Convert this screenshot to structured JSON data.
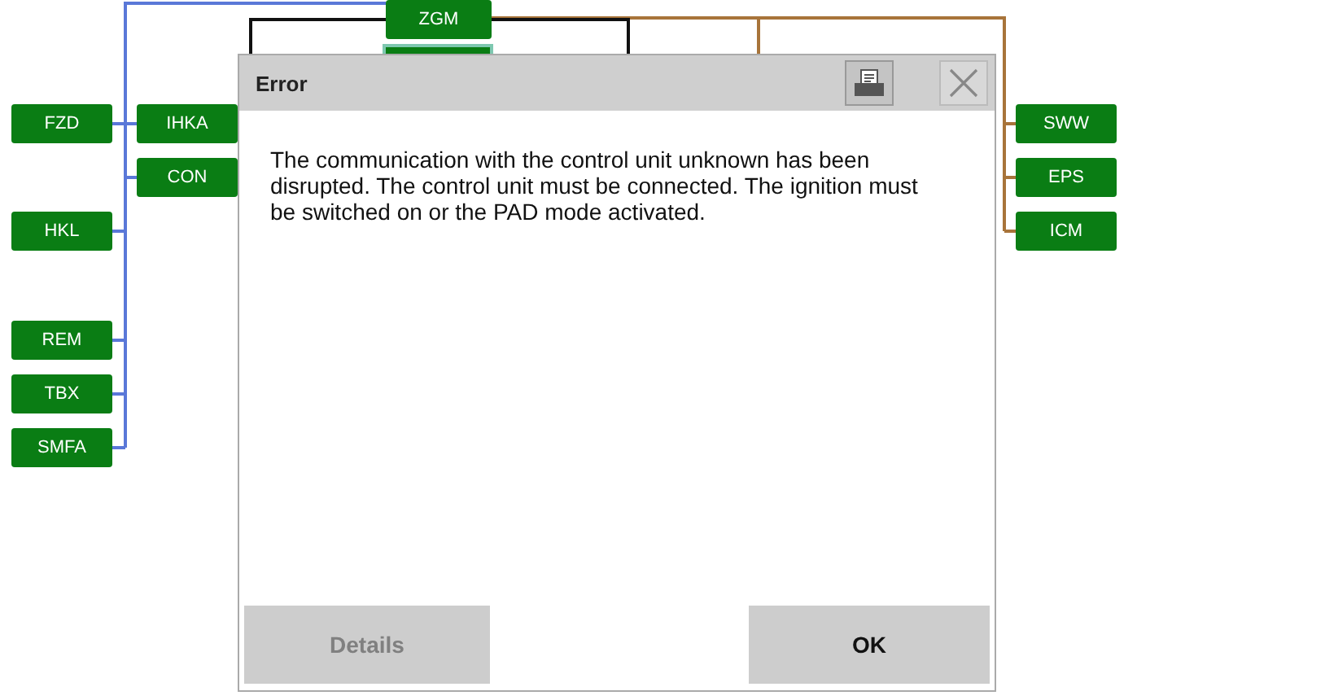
{
  "diagram": {
    "nodes": [
      {
        "label": "ZGM"
      },
      {
        "label": "FZD"
      },
      {
        "label": "IHKA"
      },
      {
        "label": "CON"
      },
      {
        "label": "HKL"
      },
      {
        "label": "REM"
      },
      {
        "label": "TBX"
      },
      {
        "label": "SMFA"
      },
      {
        "label": "SWW"
      },
      {
        "label": "EPS"
      },
      {
        "label": "ICM"
      }
    ]
  },
  "dialog": {
    "title": "Error",
    "message": "The communication with the control unit unknown has been disrupted. The control unit must be connected. The ignition must be switched on or the PAD mode activated.",
    "buttons": [
      {
        "label": "Details",
        "disabled": true
      },
      {
        "label": "OK",
        "disabled": false
      }
    ]
  }
}
